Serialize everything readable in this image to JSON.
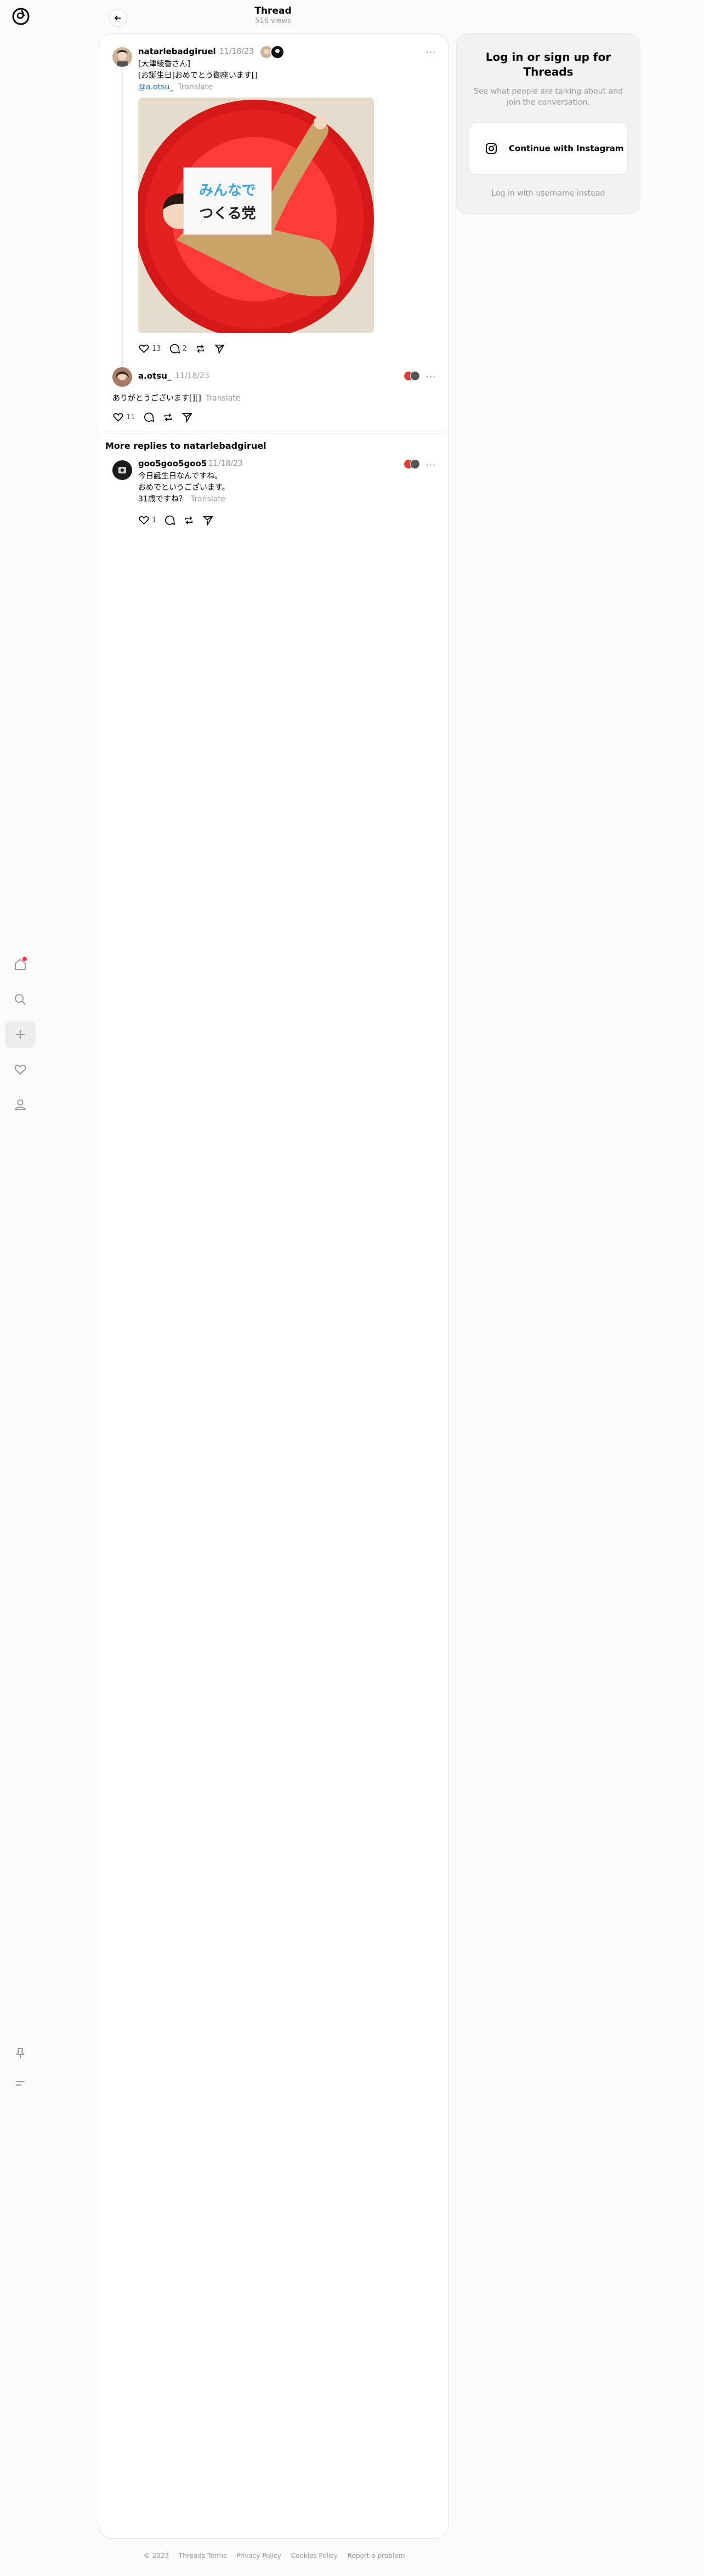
{
  "header": {
    "title": "Thread",
    "subtitle": "516 views"
  },
  "nav": {
    "items": [
      {
        "name": "home",
        "icon": "home-icon",
        "active": false,
        "badge": true
      },
      {
        "name": "search",
        "icon": "search-icon",
        "active": false
      },
      {
        "name": "create",
        "icon": "plus-icon",
        "active": true
      },
      {
        "name": "activity",
        "icon": "heart-icon",
        "active": false
      },
      {
        "name": "profile",
        "icon": "person-icon",
        "active": false
      }
    ],
    "bottom": [
      {
        "name": "pin",
        "icon": "pin-icon"
      },
      {
        "name": "menu",
        "icon": "menu-icon"
      }
    ]
  },
  "main_post": {
    "username": "natarlebadgiruel",
    "time": "11/18/23",
    "lines": [
      "[大津綾香さん]",
      "[お誕生日]おめでとう御座います[]"
    ],
    "mention": "@a.otsu_",
    "translate": "Translate",
    "image": {
      "sign_line1": "みんなで",
      "sign_line2": "つくる党"
    },
    "likes": "13",
    "replies": "2"
  },
  "reply_1": {
    "username": "a.otsu_",
    "time": "11/18/23",
    "text": "ありがとうございます[][]",
    "translate": "Translate",
    "likes": "11"
  },
  "more_replies": {
    "title": "More replies to natarlebadgiruel"
  },
  "reply_2": {
    "username": "goo5goo5goo5",
    "time": "11/18/23",
    "lines": [
      "今日誕生日なんですね。",
      "おめでというございます。"
    ],
    "last_line": "31歳ですね？",
    "translate": "Translate",
    "likes": "1"
  },
  "login_card": {
    "title": "Log in or sign up for Threads",
    "subtitle": "See what people are talking about and join the conversation.",
    "button": "Continue with Instagram",
    "alt": "Log in with username instead"
  },
  "footer": {
    "items": [
      "© 2023",
      "Threads Terms",
      "Privacy Policy",
      "Cookies Policy",
      "Report a problem"
    ]
  },
  "colors": {
    "accent_red": "#e51c1c",
    "badge": "#ff3040",
    "link": "#1b74c5"
  }
}
